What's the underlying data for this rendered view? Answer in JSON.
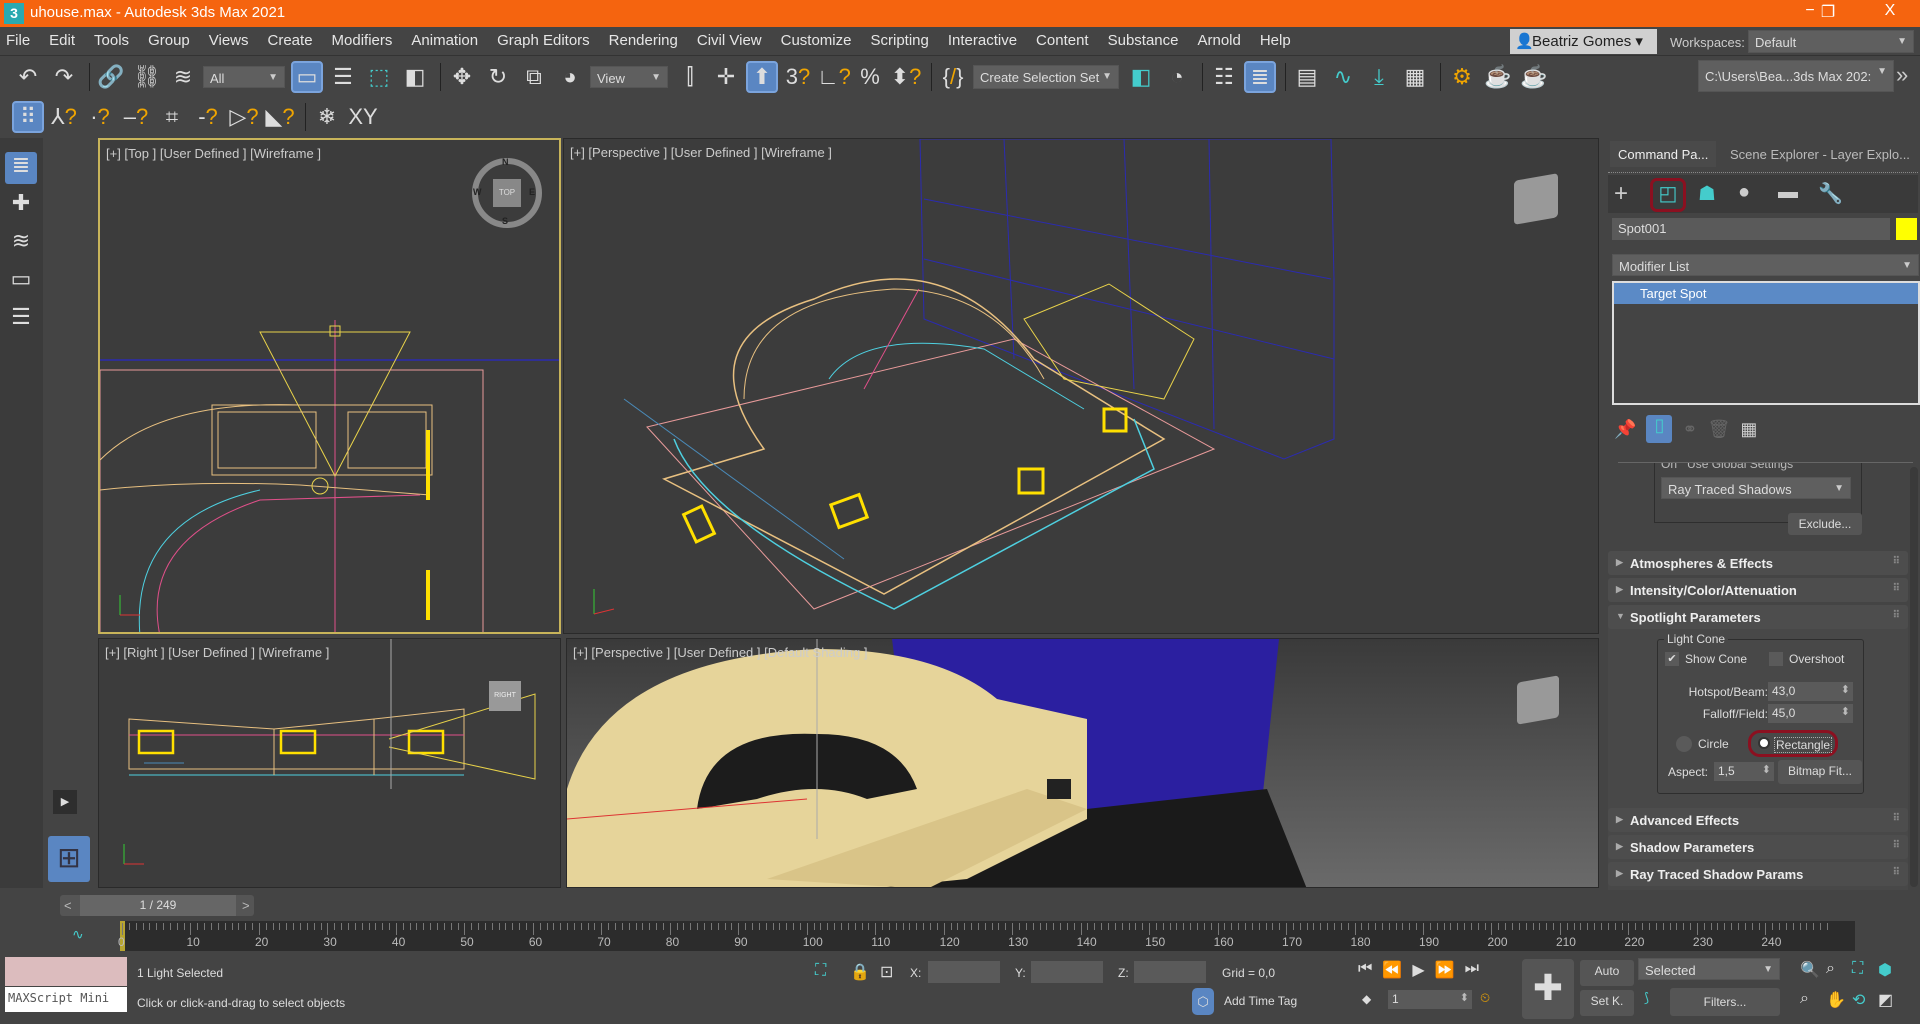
{
  "window": {
    "title": "uhouse.max - Autodesk 3ds Max 2021",
    "app_icon": "3",
    "minimize": "−",
    "maximize": "❐",
    "close": "X",
    "accent": "#f5640f"
  },
  "menu": [
    "File",
    "Edit",
    "Tools",
    "Group",
    "Views",
    "Create",
    "Modifiers",
    "Animation",
    "Graph Editors",
    "Rendering",
    "Civil View",
    "Customize",
    "Scripting",
    "Interactive",
    "Content",
    "Substance",
    "Arnold",
    "Help"
  ],
  "user": {
    "name": "Beatriz Gomes",
    "workspaces_label": "Workspaces:",
    "workspace": "Default"
  },
  "toolbar": {
    "selection_filter": "All",
    "reference_coord": "View",
    "selection_set": "Create Selection Set",
    "project_path": "C:\\Users\\Bea...3ds Max 202:",
    "more": "»",
    "snap_3d": "3"
  },
  "viewports": [
    {
      "label": "[+] [Top ] [User Defined ] [Wireframe ]",
      "viewcube": "TOP",
      "compass": [
        "N",
        "E",
        "S",
        "W"
      ]
    },
    {
      "label": "[+] [Perspective ] [User Defined ] [Wireframe ]"
    },
    {
      "label": "[+] [Right ] [User Defined ] [Wireframe ]",
      "viewcube": "RIGHT"
    },
    {
      "label": "[+] [Perspective ] [User Defined ] [Default Shading ]"
    }
  ],
  "command_panel": {
    "tabs": [
      "Command Pa...",
      "Scene Explorer - Layer Explo..."
    ],
    "object_name": "Spot001",
    "object_color": "#ffff00",
    "modifier_list": "Modifier List",
    "stack": [
      "Target Spot"
    ],
    "shadow_partial": {
      "on": "On",
      "use_global": "Use Global Settings",
      "shadow_type": "Ray Traced Shadows",
      "exclude": "Exclude..."
    },
    "rollouts": {
      "atmos": "Atmospheres & Effects",
      "intensity": "Intensity/Color/Attenuation",
      "spotlight": "Spotlight Parameters",
      "advanced": "Advanced Effects",
      "shadow": "Shadow Parameters",
      "raytraced": "Ray Traced Shadow Params"
    },
    "spot": {
      "group": "Light Cone",
      "show_cone": "Show Cone",
      "show_cone_checked": true,
      "overshoot": "Overshoot",
      "overshoot_checked": false,
      "hotspot_label": "Hotspot/Beam:",
      "hotspot": "43,0",
      "falloff_label": "Falloff/Field:",
      "falloff": "45,0",
      "circle": "Circle",
      "rectangle": "Rectangle",
      "shape_selected": "Rectangle",
      "aspect_label": "Aspect:",
      "aspect": "1,5",
      "bitmap_fit": "Bitmap Fit..."
    }
  },
  "timeline": {
    "frame": "1 / 249",
    "prev": "<",
    "next": ">",
    "ticks": [
      "0",
      "10",
      "20",
      "30",
      "40",
      "50",
      "60",
      "70",
      "80",
      "90",
      "100",
      "110",
      "120",
      "130",
      "140",
      "150",
      "160",
      "170",
      "180",
      "190",
      "200",
      "210",
      "220",
      "230",
      "240"
    ]
  },
  "status": {
    "maxscript": "MAXScript Mini",
    "selected": "1 Light Selected",
    "prompt": "Click or click-and-drag to select objects",
    "x_label": "X:",
    "y_label": "Y:",
    "z_label": "Z:",
    "grid": "Grid = 0,0",
    "add_time_tag": "Add Time Tag",
    "auto": "Auto",
    "set_key": "Set K.",
    "key_filter": "Selected",
    "filters": "Filters...",
    "current_frame": "1"
  }
}
